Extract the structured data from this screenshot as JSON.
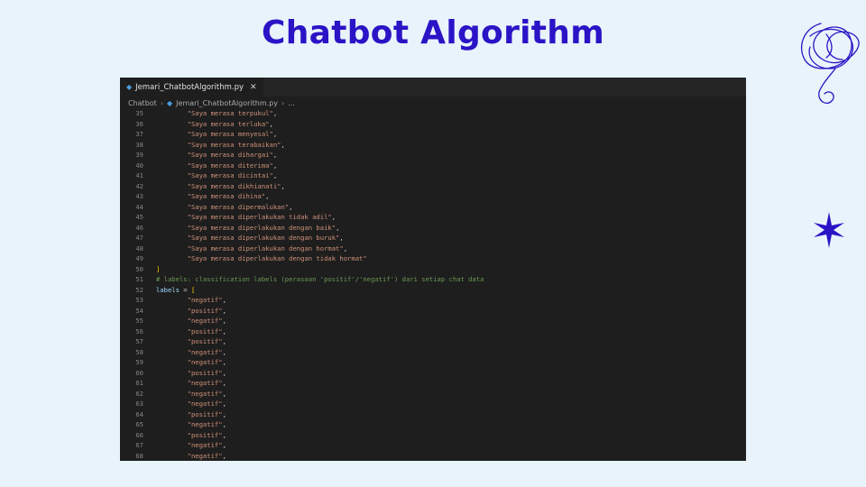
{
  "slide": {
    "title": "Chatbot Algorithm"
  },
  "editor": {
    "tab": {
      "filename": "Jemari_ChatbotAlgorithm.py",
      "close_glyph": "✕"
    },
    "breadcrumb": {
      "folder": "Chatbot",
      "file": "Jemari_ChatbotAlgorithm.py",
      "trail": "..."
    }
  },
  "code_lines": [
    {
      "n": "35",
      "parts": [
        {
          "t": "        ",
          "c": "txt"
        },
        {
          "t": "\"Saya merasa terpukul\"",
          "c": "str"
        },
        {
          "t": ",",
          "c": "txt"
        }
      ]
    },
    {
      "n": "36",
      "parts": [
        {
          "t": "        ",
          "c": "txt"
        },
        {
          "t": "\"Saya merasa terluka\"",
          "c": "str"
        },
        {
          "t": ",",
          "c": "txt"
        }
      ]
    },
    {
      "n": "37",
      "parts": [
        {
          "t": "        ",
          "c": "txt"
        },
        {
          "t": "\"Saya merasa menyesal\"",
          "c": "str"
        },
        {
          "t": ",",
          "c": "txt"
        }
      ]
    },
    {
      "n": "38",
      "parts": [
        {
          "t": "        ",
          "c": "txt"
        },
        {
          "t": "\"Saya merasa terabaikan\"",
          "c": "str"
        },
        {
          "t": ",",
          "c": "txt"
        }
      ]
    },
    {
      "n": "39",
      "parts": [
        {
          "t": "        ",
          "c": "txt"
        },
        {
          "t": "\"Saya merasa dihargai\"",
          "c": "str"
        },
        {
          "t": ",",
          "c": "txt"
        }
      ]
    },
    {
      "n": "40",
      "parts": [
        {
          "t": "        ",
          "c": "txt"
        },
        {
          "t": "\"Saya merasa diterima\"",
          "c": "str"
        },
        {
          "t": ",",
          "c": "txt"
        }
      ]
    },
    {
      "n": "41",
      "parts": [
        {
          "t": "        ",
          "c": "txt"
        },
        {
          "t": "\"Saya merasa dicintai\"",
          "c": "str"
        },
        {
          "t": ",",
          "c": "txt"
        }
      ]
    },
    {
      "n": "42",
      "parts": [
        {
          "t": "        ",
          "c": "txt"
        },
        {
          "t": "\"Saya merasa dikhianati\"",
          "c": "str"
        },
        {
          "t": ",",
          "c": "txt"
        }
      ]
    },
    {
      "n": "43",
      "parts": [
        {
          "t": "        ",
          "c": "txt"
        },
        {
          "t": "\"Saya merasa dihina\"",
          "c": "str"
        },
        {
          "t": ",",
          "c": "txt"
        }
      ]
    },
    {
      "n": "44",
      "parts": [
        {
          "t": "        ",
          "c": "txt"
        },
        {
          "t": "\"Saya merasa dipermalukan\"",
          "c": "str"
        },
        {
          "t": ",",
          "c": "txt"
        }
      ]
    },
    {
      "n": "45",
      "parts": [
        {
          "t": "        ",
          "c": "txt"
        },
        {
          "t": "\"Saya merasa diperlakukan tidak adil\"",
          "c": "str"
        },
        {
          "t": ",",
          "c": "txt"
        }
      ]
    },
    {
      "n": "46",
      "parts": [
        {
          "t": "        ",
          "c": "txt"
        },
        {
          "t": "\"Saya merasa diperlakukan dengan baik\"",
          "c": "str"
        },
        {
          "t": ",",
          "c": "txt"
        }
      ]
    },
    {
      "n": "47",
      "parts": [
        {
          "t": "        ",
          "c": "txt"
        },
        {
          "t": "\"Saya merasa diperlakukan dengan buruk\"",
          "c": "str"
        },
        {
          "t": ",",
          "c": "txt"
        }
      ]
    },
    {
      "n": "48",
      "parts": [
        {
          "t": "        ",
          "c": "txt"
        },
        {
          "t": "\"Saya merasa diperlakukan dengan hormat\"",
          "c": "str"
        },
        {
          "t": ",",
          "c": "txt"
        }
      ]
    },
    {
      "n": "49",
      "parts": [
        {
          "t": "        ",
          "c": "txt"
        },
        {
          "t": "\"Saya merasa diperlakukan dengan tidak hormat\"",
          "c": "str"
        }
      ]
    },
    {
      "n": "50",
      "parts": [
        {
          "t": "]",
          "c": "brk"
        }
      ]
    },
    {
      "n": "51",
      "parts": [
        {
          "t": "# labels: classification labels (perasaan 'positif'/'negatif') dari setiap chat data",
          "c": "cmt"
        }
      ]
    },
    {
      "n": "52",
      "parts": [
        {
          "t": "labels",
          "c": "var"
        },
        {
          "t": " = ",
          "c": "txt"
        },
        {
          "t": "[",
          "c": "brk"
        }
      ]
    },
    {
      "n": "53",
      "parts": [
        {
          "t": "        ",
          "c": "txt"
        },
        {
          "t": "\"negatif\"",
          "c": "str"
        },
        {
          "t": ",",
          "c": "txt"
        }
      ]
    },
    {
      "n": "54",
      "parts": [
        {
          "t": "        ",
          "c": "txt"
        },
        {
          "t": "\"positif\"",
          "c": "str"
        },
        {
          "t": ",",
          "c": "txt"
        }
      ]
    },
    {
      "n": "55",
      "parts": [
        {
          "t": "        ",
          "c": "txt"
        },
        {
          "t": "\"negatif\"",
          "c": "str"
        },
        {
          "t": ",",
          "c": "txt"
        }
      ]
    },
    {
      "n": "56",
      "parts": [
        {
          "t": "        ",
          "c": "txt"
        },
        {
          "t": "\"positif\"",
          "c": "str"
        },
        {
          "t": ",",
          "c": "txt"
        }
      ]
    },
    {
      "n": "57",
      "parts": [
        {
          "t": "        ",
          "c": "txt"
        },
        {
          "t": "\"positif\"",
          "c": "str"
        },
        {
          "t": ",",
          "c": "txt"
        }
      ]
    },
    {
      "n": "58",
      "parts": [
        {
          "t": "        ",
          "c": "txt"
        },
        {
          "t": "\"negatif\"",
          "c": "str"
        },
        {
          "t": ",",
          "c": "txt"
        }
      ]
    },
    {
      "n": "59",
      "parts": [
        {
          "t": "        ",
          "c": "txt"
        },
        {
          "t": "\"negatif\"",
          "c": "str"
        },
        {
          "t": ",",
          "c": "txt"
        }
      ]
    },
    {
      "n": "60",
      "parts": [
        {
          "t": "        ",
          "c": "txt"
        },
        {
          "t": "\"positif\"",
          "c": "str"
        },
        {
          "t": ",",
          "c": "txt"
        }
      ]
    },
    {
      "n": "61",
      "parts": [
        {
          "t": "        ",
          "c": "txt"
        },
        {
          "t": "\"negatif\"",
          "c": "str"
        },
        {
          "t": ",",
          "c": "txt"
        }
      ]
    },
    {
      "n": "62",
      "parts": [
        {
          "t": "        ",
          "c": "txt"
        },
        {
          "t": "\"negatif\"",
          "c": "str"
        },
        {
          "t": ",",
          "c": "txt"
        }
      ]
    },
    {
      "n": "63",
      "parts": [
        {
          "t": "        ",
          "c": "txt"
        },
        {
          "t": "\"negatif\"",
          "c": "str"
        },
        {
          "t": ",",
          "c": "txt"
        }
      ]
    },
    {
      "n": "64",
      "parts": [
        {
          "t": "        ",
          "c": "txt"
        },
        {
          "t": "\"positif\"",
          "c": "str"
        },
        {
          "t": ",",
          "c": "txt"
        }
      ]
    },
    {
      "n": "65",
      "parts": [
        {
          "t": "        ",
          "c": "txt"
        },
        {
          "t": "\"negatif\"",
          "c": "str"
        },
        {
          "t": ",",
          "c": "txt"
        }
      ]
    },
    {
      "n": "66",
      "parts": [
        {
          "t": "        ",
          "c": "txt"
        },
        {
          "t": "\"positif\"",
          "c": "str"
        },
        {
          "t": ",",
          "c": "txt"
        }
      ]
    },
    {
      "n": "67",
      "parts": [
        {
          "t": "        ",
          "c": "txt"
        },
        {
          "t": "\"negatif\"",
          "c": "str"
        },
        {
          "t": ",",
          "c": "txt"
        }
      ]
    },
    {
      "n": "68",
      "parts": [
        {
          "t": "        ",
          "c": "txt"
        },
        {
          "t": "\"negatif\"",
          "c": "str"
        },
        {
          "t": ",",
          "c": "txt"
        }
      ]
    }
  ],
  "decorations": {
    "scribble_icon": "scribble-icon",
    "sparkle_icon": "sparkle-icon"
  },
  "colors": {
    "background": "#e8f3fb",
    "title": "#2b13c6",
    "editor_bg": "#1e1e1e",
    "string": "#ce9178",
    "comment": "#6a9955",
    "variable": "#9cdcfe",
    "bracket": "#ffd700",
    "line_number": "#858585"
  }
}
